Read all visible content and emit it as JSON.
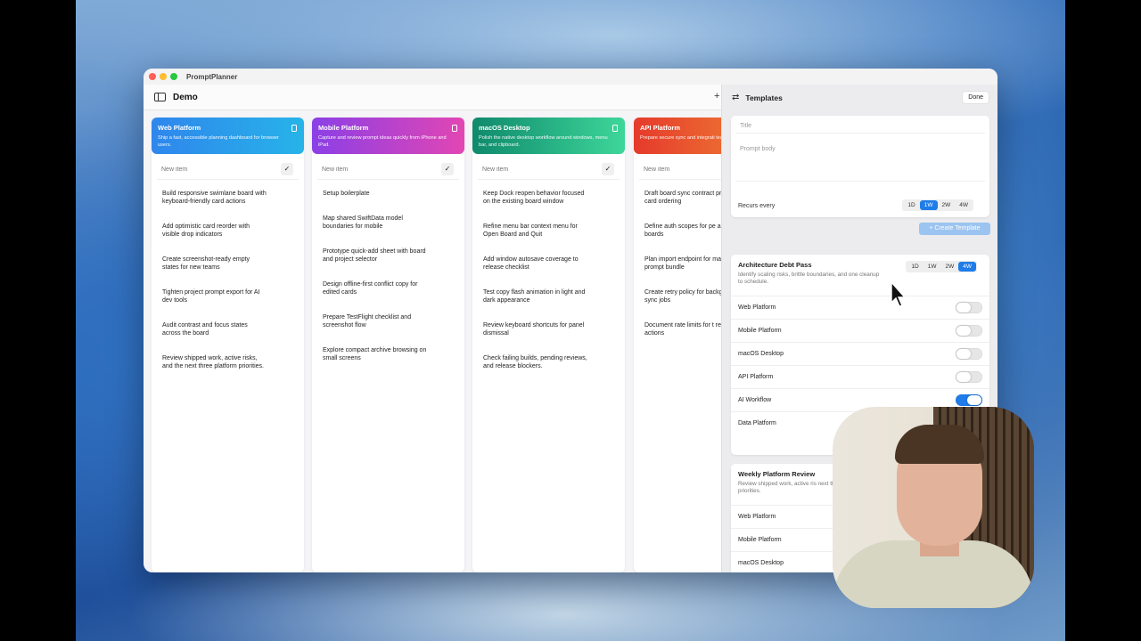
{
  "app": {
    "title": "PromptPlanner"
  },
  "toolbar": {
    "board_title": "Demo",
    "add_symbol": "+"
  },
  "columns": [
    {
      "name": "Web Platform",
      "description": "Ship a fast, accessible planning dashboard for browser users.",
      "color_from": "#2f86ec",
      "color_to": "#27b3e9",
      "new_item_placeholder": "New item",
      "items": [
        "Build responsive swimlane board with keyboard-friendly card actions",
        "Add optimistic card reorder with visible drop indicators",
        "Create screenshot-ready empty states for new teams",
        "Tighten project prompt export for AI dev tools",
        "Audit contrast and focus states across the board",
        "Review shipped work, active risks, and the next three platform priorities."
      ]
    },
    {
      "name": "Mobile Platform",
      "description": "Capture and review prompt ideas quickly from iPhone and iPad.",
      "color_from": "#8b3fe6",
      "color_to": "#e246b3",
      "new_item_placeholder": "New item",
      "items": [
        "Setup boilerplate",
        "Map shared SwiftData model boundaries for mobile",
        "Prototype quick-add sheet with board and project selector",
        "Design offline-first conflict copy for edited cards",
        "Prepare TestFlight checklist and screenshot flow",
        "Explore compact archive browsing on small screens"
      ]
    },
    {
      "name": "macOS Desktop",
      "description": "Polish the native desktop workflow around windows, menu bar, and clipboard.",
      "color_from": "#0f8a6c",
      "color_to": "#3ed69a",
      "new_item_placeholder": "New item",
      "items": [
        "Keep Dock reopen behavior focused on the existing board window",
        "Refine menu bar context menu for Open Board and Quit",
        "Add window autosave coverage to release checklist",
        "Test copy flash animation in light and dark appearance",
        "Review keyboard shortcuts for panel dismissal",
        "Check failing builds, pending reviews, and release blockers."
      ]
    },
    {
      "name": "API Platform",
      "description": "Prepare secure sync and integrati team workflows.",
      "color_from": "#e53a2c",
      "color_to": "#f08a35",
      "new_item_placeholder": "New item",
      "items": [
        "Draft board sync contract project and card ordering",
        "Define auth scopes for pe and team boards",
        "Plan import endpoint for markdown prompt bundle",
        "Create retry policy for background sync jobs",
        "Document rate limits for t recurrence actions"
      ]
    }
  ],
  "templates_panel": {
    "title": "Templates",
    "done_label": "Done",
    "form": {
      "title_placeholder": "Title",
      "body_placeholder": "Prompt body",
      "recurs_label": "Recurs every",
      "intervals": [
        "1D",
        "1W",
        "2W",
        "4W"
      ],
      "selected_interval": "1W",
      "create_label": "+  Create Template"
    },
    "templates": [
      {
        "name": "Architecture Debt Pass",
        "description": "Identify scaling risks, brittle boundaries, and one cleanup to schedule.",
        "intervals": [
          "1D",
          "1W",
          "2W",
          "4W"
        ],
        "selected_interval": "4W",
        "boards": [
          {
            "name": "Web Platform",
            "enabled": false
          },
          {
            "name": "Mobile Platform",
            "enabled": false
          },
          {
            "name": "macOS Desktop",
            "enabled": false
          },
          {
            "name": "API Platform",
            "enabled": false
          },
          {
            "name": "AI Workflow",
            "enabled": true
          },
          {
            "name": "Data Platform",
            "enabled": false
          }
        ]
      },
      {
        "name": "Weekly Platform Review",
        "description": "Review shipped work, active ris next three platform priorities.",
        "boards": [
          {
            "name": "Web Platform"
          },
          {
            "name": "Mobile Platform"
          },
          {
            "name": "macOS Desktop"
          }
        ]
      }
    ]
  },
  "colors": {
    "accent": "#1f7ce8",
    "window_bg": "#f5f5f7"
  }
}
